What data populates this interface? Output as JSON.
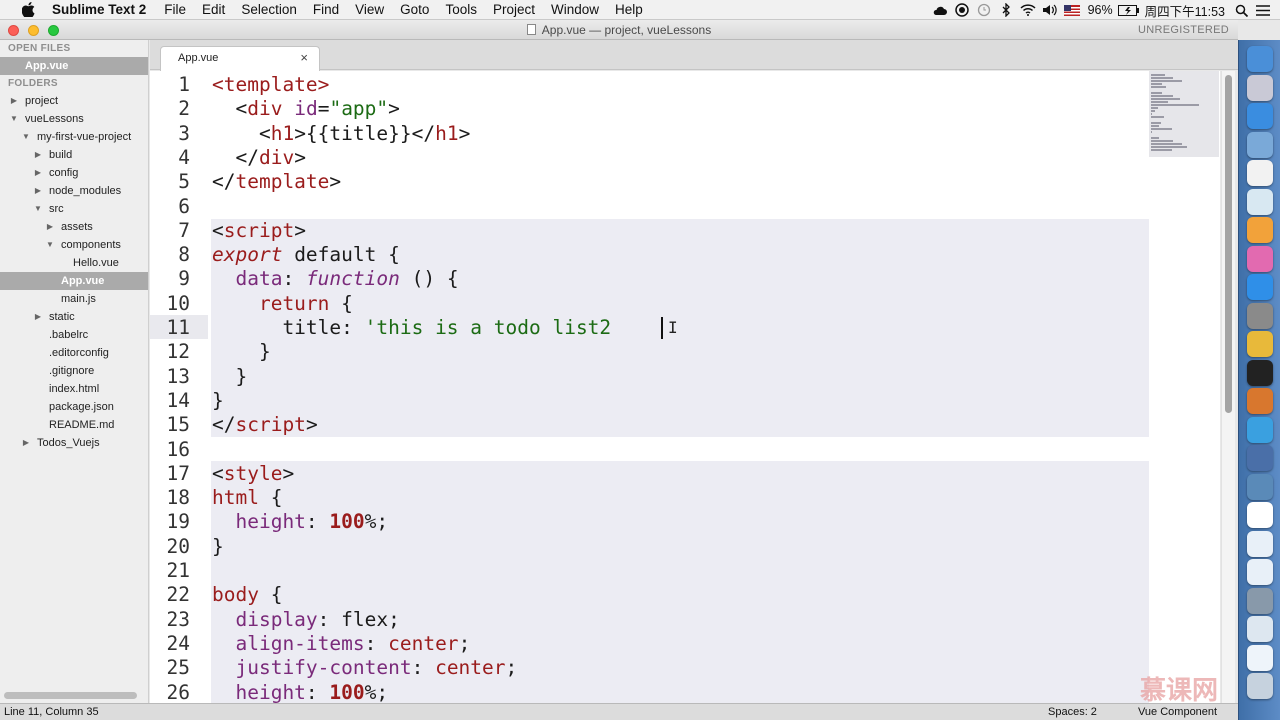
{
  "menubar": {
    "app_name": "Sublime Text 2",
    "items": [
      "File",
      "Edit",
      "Selection",
      "Find",
      "View",
      "Goto",
      "Tools",
      "Project",
      "Window",
      "Help"
    ],
    "battery": "96%",
    "clock": "周四下午11:53"
  },
  "window": {
    "title": "App.vue — project, vueLessons",
    "unregistered": "UNREGISTERED"
  },
  "sidebar": {
    "open_files_header": "OPEN FILES",
    "open_files": [
      "App.vue"
    ],
    "folders_header": "FOLDERS",
    "tree": [
      {
        "label": "project",
        "depth": 0,
        "arrow": "right"
      },
      {
        "label": "vueLessons",
        "depth": 0,
        "arrow": "down"
      },
      {
        "label": "my-first-vue-project",
        "depth": 1,
        "arrow": "down"
      },
      {
        "label": "build",
        "depth": 2,
        "arrow": "right"
      },
      {
        "label": "config",
        "depth": 2,
        "arrow": "right"
      },
      {
        "label": "node_modules",
        "depth": 2,
        "arrow": "right"
      },
      {
        "label": "src",
        "depth": 2,
        "arrow": "down"
      },
      {
        "label": "assets",
        "depth": 3,
        "arrow": "right"
      },
      {
        "label": "components",
        "depth": 3,
        "arrow": "down"
      },
      {
        "label": "Hello.vue",
        "depth": 4,
        "arrow": ""
      },
      {
        "label": "App.vue",
        "depth": 3,
        "arrow": "",
        "selected": true
      },
      {
        "label": "main.js",
        "depth": 3,
        "arrow": ""
      },
      {
        "label": "static",
        "depth": 2,
        "arrow": "right"
      },
      {
        "label": ".babelrc",
        "depth": 2,
        "arrow": ""
      },
      {
        "label": ".editorconfig",
        "depth": 2,
        "arrow": ""
      },
      {
        "label": ".gitignore",
        "depth": 2,
        "arrow": ""
      },
      {
        "label": "index.html",
        "depth": 2,
        "arrow": ""
      },
      {
        "label": "package.json",
        "depth": 2,
        "arrow": ""
      },
      {
        "label": "README.md",
        "depth": 2,
        "arrow": ""
      },
      {
        "label": "Todos_Vuejs",
        "depth": 1,
        "arrow": "right"
      }
    ]
  },
  "tab": {
    "label": "App.vue",
    "close": "×"
  },
  "editor": {
    "current_line": 11,
    "lines": [
      [
        [
          "tag",
          "<template>"
        ]
      ],
      [
        [
          "punct",
          "  <"
        ],
        [
          "tag",
          "div"
        ],
        [
          "attr",
          " id"
        ],
        [
          "punct",
          "="
        ],
        [
          "str",
          "\"app\""
        ],
        [
          "punct",
          ">"
        ]
      ],
      [
        [
          "punct",
          "    <"
        ],
        [
          "tag",
          "h1"
        ],
        [
          "punct",
          ">{{title}}</"
        ],
        [
          "tag",
          "h1"
        ],
        [
          "punct",
          ">"
        ]
      ],
      [
        [
          "punct",
          "  </"
        ],
        [
          "tag",
          "div"
        ],
        [
          "punct",
          ">"
        ]
      ],
      [
        [
          "punct",
          "</"
        ],
        [
          "tag",
          "template"
        ],
        [
          "punct",
          ">"
        ]
      ],
      [
        [
          "punct",
          ""
        ]
      ],
      [
        [
          "punct",
          "<"
        ],
        [
          "tag",
          "script"
        ],
        [
          "punct",
          ">"
        ]
      ],
      [
        [
          "kw",
          "export"
        ],
        [
          "punct",
          " default {"
        ]
      ],
      [
        [
          "prop",
          "  data"
        ],
        [
          "punct",
          ": "
        ],
        [
          "fn",
          "function"
        ],
        [
          "punct",
          " () {"
        ]
      ],
      [
        [
          "tag",
          "    return"
        ],
        [
          "punct",
          " {"
        ]
      ],
      [
        [
          "punct",
          "      title: "
        ],
        [
          "str",
          "'this is a todo list2"
        ]
      ],
      [
        [
          "punct",
          "    }"
        ]
      ],
      [
        [
          "punct",
          "  }"
        ]
      ],
      [
        [
          "punct",
          "}"
        ]
      ],
      [
        [
          "punct",
          "</"
        ],
        [
          "tag",
          "script"
        ],
        [
          "punct",
          ">"
        ]
      ],
      [
        [
          "punct",
          ""
        ]
      ],
      [
        [
          "punct",
          "<"
        ],
        [
          "tag",
          "style"
        ],
        [
          "punct",
          ">"
        ]
      ],
      [
        [
          "tag",
          "html"
        ],
        [
          "punct",
          " {"
        ]
      ],
      [
        [
          "prop",
          "  height"
        ],
        [
          "punct",
          ": "
        ],
        [
          "num",
          "100"
        ],
        [
          "punct",
          "%;"
        ]
      ],
      [
        [
          "punct",
          "}"
        ]
      ],
      [
        [
          "punct",
          ""
        ]
      ],
      [
        [
          "tag",
          "body"
        ],
        [
          "punct",
          " {"
        ]
      ],
      [
        [
          "prop",
          "  display"
        ],
        [
          "punct",
          ": flex;"
        ]
      ],
      [
        [
          "prop",
          "  align-items"
        ],
        [
          "punct",
          ": "
        ],
        [
          "val",
          "center"
        ],
        [
          "punct",
          ";"
        ]
      ],
      [
        [
          "prop",
          "  justify-content"
        ],
        [
          "punct",
          ": "
        ],
        [
          "val",
          "center"
        ],
        [
          "punct",
          ";"
        ]
      ],
      [
        [
          "prop",
          "  height"
        ],
        [
          "punct",
          ": "
        ],
        [
          "num",
          "100"
        ],
        [
          "punct",
          "%;"
        ]
      ]
    ]
  },
  "statusbar": {
    "position": "Line 11, Column 35",
    "spaces": "Spaces: 2",
    "syntax": "Vue Component"
  },
  "watermark": "慕课网",
  "dock_icons": [
    "finder-icon",
    "launchpad-icon",
    "safari-icon",
    "preview-icon",
    "calendar-icon",
    "photos-icon",
    "photo-app-icon",
    "itunes-icon",
    "app-store-icon",
    "system-preferences-icon",
    "chrome-icon",
    "terminal-icon",
    "sublime-icon",
    "keynote-icon",
    "screen-sharing-icon",
    "quicktime-icon",
    "printer-icon",
    "window-1-icon",
    "window-2-icon",
    "window-3-icon",
    "window-4-icon",
    "window-5-icon",
    "trash-icon"
  ]
}
